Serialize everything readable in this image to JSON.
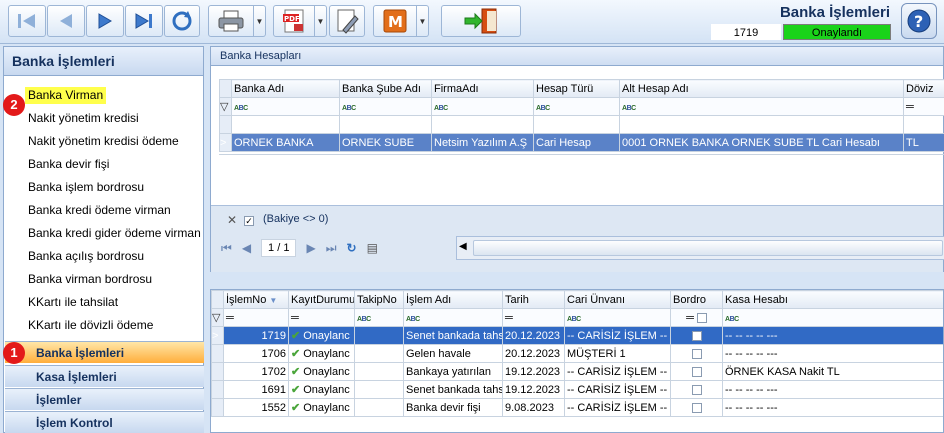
{
  "window": {
    "title": "Banka İşlemleri",
    "doc_no": "1719",
    "status": "Onaylandı"
  },
  "toolbar": {
    "icons": [
      "first-record-icon",
      "previous-record-icon",
      "next-record-icon",
      "last-record-icon",
      "refresh-icon",
      "print-icon",
      "pdf-export-icon",
      "edit-document-icon",
      "m-icon",
      "exit-door-icon",
      "help-icon"
    ]
  },
  "left": {
    "title": "Banka İşlemleri",
    "items": [
      "Banka Virman",
      "Nakit yönetim kredisi",
      "Nakit yönetim kredisi ödeme",
      "Banka devir fişi",
      "Banka işlem bordrosu",
      "Banka kredi ödeme virman",
      "Banka kredi gider ödeme virman",
      "Banka açılış bordrosu",
      "Banka virman bordrosu",
      "KKartı ile tahsilat",
      "KKartı ile dövizli ödeme"
    ],
    "groups": [
      "Banka İşlemleri",
      "Kasa İşlemleri",
      "İşlemler",
      "İşlem Kontrol"
    ],
    "badges": [
      "1",
      "2"
    ]
  },
  "accounts": {
    "title": "Banka Hesapları",
    "columns": [
      "Banka Adı",
      "Banka Şube Adı",
      "FirmaAdı",
      "Hesap Türü",
      "Alt Hesap Adı",
      "Döviz"
    ],
    "row": [
      "ORNEK BANKA",
      "ORNEK SUBE",
      "Netsim Yazılım A.Ş",
      "Cari Hesap",
      "0001 ORNEK BANKA ORNEK SUBE TL Cari Hesabı",
      "TL"
    ],
    "filter_text": "(Bakiye <> 0)",
    "pager": "1 / 1"
  },
  "ops": {
    "columns": [
      "İşlemNo",
      "KayıtDurumu",
      "TakipNo",
      "İşlem Adı",
      "Tarih",
      "Cari Ünvanı",
      "Bordro",
      "Kasa Hesabı"
    ],
    "rows": [
      {
        "no": "1719",
        "status": "Onaylanc",
        "takip": "",
        "islem": "Senet bankada tahs",
        "tarih": "20.12.2023",
        "cari": "-- CARİSİZ İŞLEM --",
        "kasa": "-- -- -- -- ---"
      },
      {
        "no": "1706",
        "status": "Onaylanc",
        "takip": "",
        "islem": "Gelen havale",
        "tarih": "20.12.2023",
        "cari": "MÜŞTERİ 1",
        "kasa": "-- -- -- -- ---"
      },
      {
        "no": "1702",
        "status": "Onaylanc",
        "takip": "",
        "islem": "Bankaya yatırılan",
        "tarih": "19.12.2023",
        "cari": "-- CARİSİZ İŞLEM --",
        "kasa": "ÖRNEK KASA Nakit TL"
      },
      {
        "no": "1691",
        "status": "Onaylanc",
        "takip": "",
        "islem": "Senet bankada tahs",
        "tarih": "19.12.2023",
        "cari": "-- CARİSİZ İŞLEM --",
        "kasa": "-- -- -- -- ---"
      },
      {
        "no": "1552",
        "status": "Onaylanc",
        "takip": "",
        "islem": "Banka devir fişi",
        "tarih": "9.08.2023",
        "cari": "-- CARİSİZ İŞLEM --",
        "kasa": "-- -- -- -- ---"
      }
    ]
  },
  "colors": {
    "status_green": "#1ad31a",
    "highlight_yellow": "#ffff4c",
    "badge_red": "#e31a1a",
    "selection_blue": "#316ac5"
  }
}
